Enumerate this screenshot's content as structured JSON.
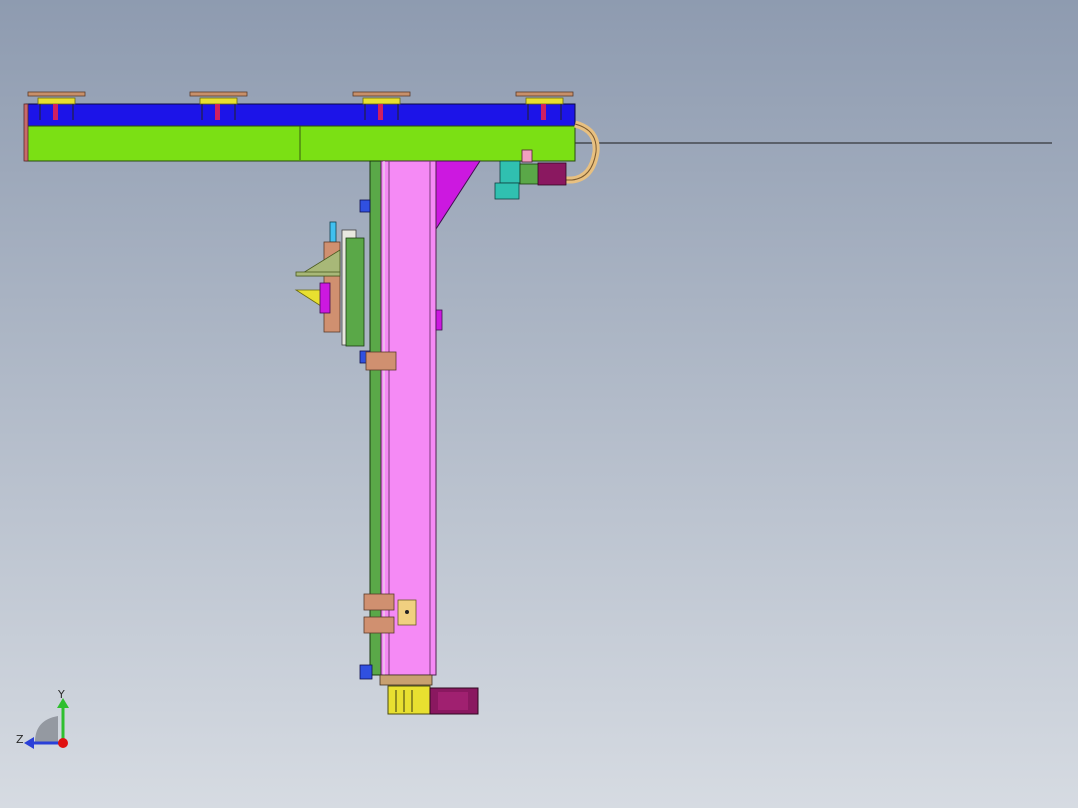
{
  "viewport": {
    "background_top": "#8e9bb0",
    "background_bottom": "#d6dbe2"
  },
  "triad": {
    "y_label": "Y",
    "z_label": "Z",
    "colors": {
      "y": "#2fbf2f",
      "z": "#2a40d8",
      "x": "#e01010"
    }
  },
  "model_colors": {
    "beam_top": "#1c14e8",
    "beam_bottom": "#7be014",
    "column": "#f58af5",
    "gusset": "#cc18e0",
    "motor": "#8a1860",
    "gear": "#e8e030",
    "cable": "#e8c080",
    "pad": "#d09070",
    "carriage": "#5aa848"
  }
}
